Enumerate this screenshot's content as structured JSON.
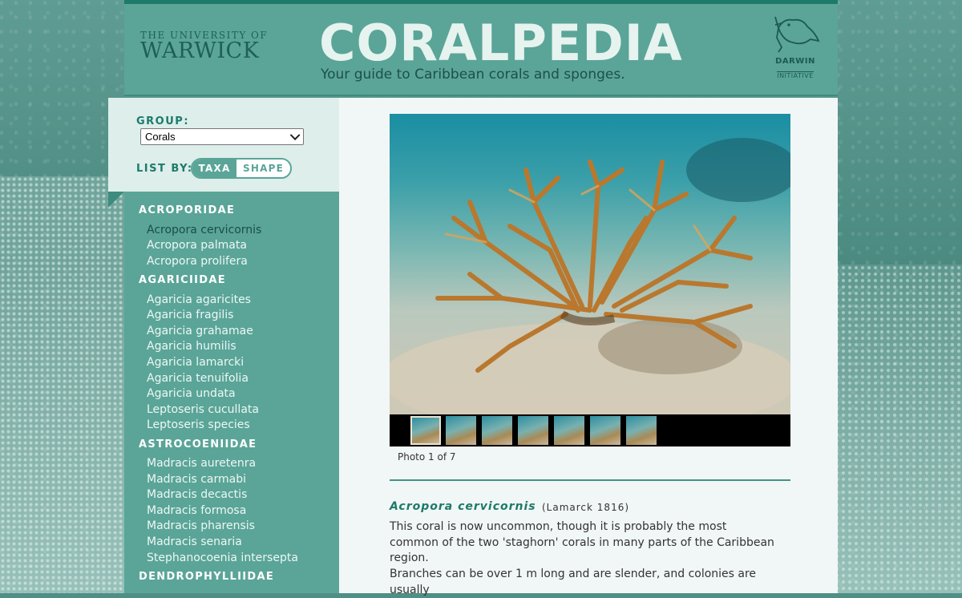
{
  "header": {
    "university_small": "THE UNIVERSITY OF",
    "university_big": "WARWICK",
    "title": "CORALPEDIA",
    "tagline": "Your guide to Caribbean corals and sponges.",
    "partner_line1": "DARWIN",
    "partner_line2": "INITIATIVE"
  },
  "controls": {
    "group_label": "GROUP:",
    "group_value": "Corals",
    "list_by_label": "LIST BY:",
    "toggle_taxa": "TAXA",
    "toggle_shape": "SHAPE"
  },
  "sidebar": {
    "families": [
      {
        "name": "ACROPORIDAE",
        "species": [
          "Acropora cervicornis",
          "Acropora palmata",
          "Acropora prolifera"
        ]
      },
      {
        "name": "AGARICIIDAE",
        "species": [
          "Agaricia agaricites",
          "Agaricia fragilis",
          "Agaricia grahamae",
          "Agaricia humilis",
          "Agaricia lamarcki",
          "Agaricia tenuifolia",
          "Agaricia undata",
          "Leptoseris cucullata",
          "Leptoseris species"
        ]
      },
      {
        "name": "ASTROCOENIIDAE",
        "species": [
          "Madracis auretenra",
          "Madracis carmabi",
          "Madracis decactis",
          "Madracis formosa",
          "Madracis pharensis",
          "Madracis senaria",
          "Stephanocoenia intersepta"
        ]
      },
      {
        "name": "DENDROPHYLLIIDAE",
        "species": []
      }
    ]
  },
  "content": {
    "photo_caption": "Photo 1 of 7",
    "thumbnail_count": 7,
    "species_name": "Acropora cervicornis",
    "authority": "(Lamarck 1816)",
    "paragraph1": "This coral is now uncommon, though it is probably the most common of the two 'staghorn' corals in many parts of the Caribbean region.",
    "paragraph2": "Branches can be over 1 m long and are slender, and colonies are usually"
  },
  "colors": {
    "header_bg": "#5aa598",
    "accent_dark": "#1d7a6a",
    "sidebar_bg": "#5aa598",
    "content_bg": "#f1f7f6"
  }
}
